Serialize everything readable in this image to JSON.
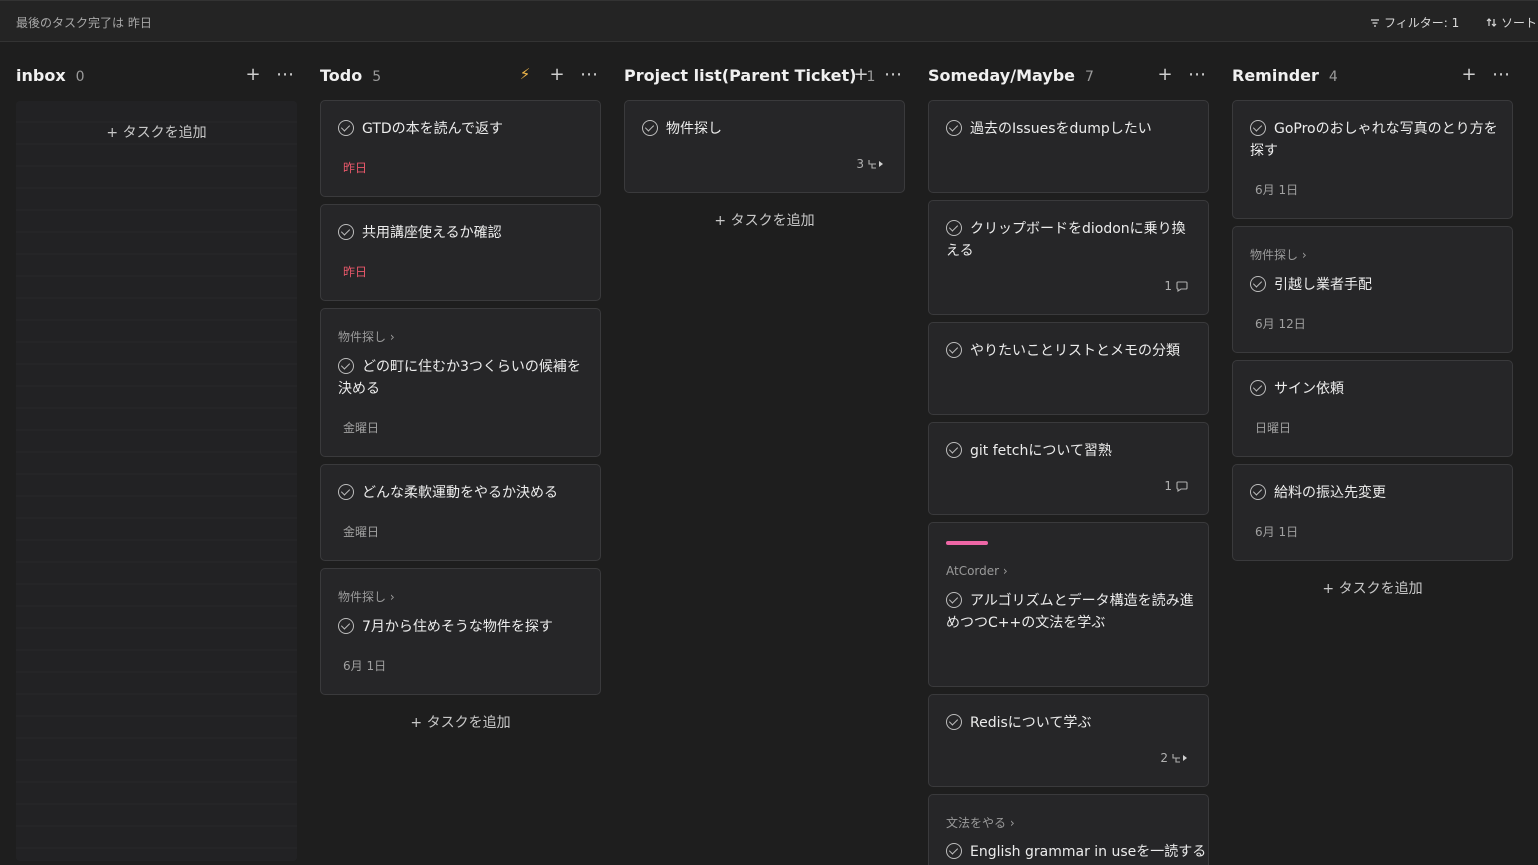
{
  "topbar": {
    "status": "最後のタスク完了は 昨日",
    "filter_label": "フィルター: 1",
    "sort_label": "ソート"
  },
  "add_task_label": "+ タスクを追加",
  "columns": [
    {
      "title": "inbox",
      "count": "0"
    },
    {
      "title": "Todo",
      "count": "5"
    },
    {
      "title": "Project list(Parent Ticket)",
      "count": "1"
    },
    {
      "title": "Someday/Maybe",
      "count": "7"
    },
    {
      "title": "Reminder",
      "count": "4"
    }
  ],
  "todo": [
    {
      "task": "GTDの本を読んで返す",
      "date": "昨日"
    },
    {
      "task": "共用講座使えるか確認",
      "date": "昨日"
    },
    {
      "parent": "物件探し",
      "task": "どの町に住むか3つくらいの候補を決める",
      "date": "金曜日"
    },
    {
      "task": "どんな柔軟運動をやるか決める",
      "date": "金曜日"
    },
    {
      "parent": "物件探し",
      "task": "7月から住めそうな物件を探す",
      "date": "6月 1日"
    }
  ],
  "project": [
    {
      "task": "物件探し",
      "subtasks": "3"
    }
  ],
  "someday": [
    {
      "task": "過去のIssuesをdumpしたい"
    },
    {
      "task": "クリップボードをdiodonに乗り換える",
      "comments": "1"
    },
    {
      "task": "やりたいことリストとメモの分類"
    },
    {
      "task": "git fetchについて習熟",
      "comments": "1"
    },
    {
      "parent": "AtCorder",
      "task": "アルゴリズムとデータ構造を読み進めつつC++の文法を学ぶ",
      "label_color": "#ee66a6"
    },
    {
      "task": "Redisについて学ぶ",
      "subtasks": "2"
    },
    {
      "parent": "文法をやる",
      "task": "English grammar in useを一読する"
    }
  ],
  "reminder": [
    {
      "task": "GoProのおしゃれな写真のとり方を探す",
      "date": "6月 1日"
    },
    {
      "parent": "物件探し",
      "task": "引越し業者手配",
      "date": "6月 12日"
    },
    {
      "task": "サイン依頼",
      "date": "日曜日"
    },
    {
      "task": "給料の振込先変更",
      "date": "6月 1日"
    }
  ]
}
